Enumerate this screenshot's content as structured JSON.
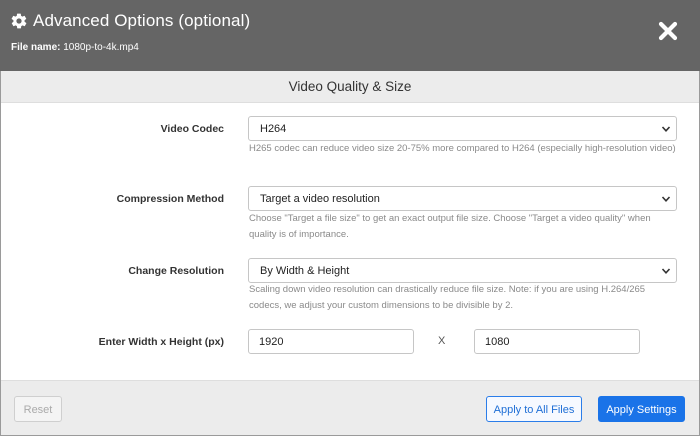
{
  "header": {
    "title": "Advanced Options (optional)",
    "file_label": "File name:",
    "file_name": "1080p-to-4k.mp4",
    "title_icon": "gear-icon",
    "close_icon": "close-icon"
  },
  "section": {
    "title": "Video Quality & Size"
  },
  "fields": {
    "codec": {
      "label": "Video Codec",
      "value": "H264",
      "help": "H265 codec can reduce video size 20-75% more compared to H264 (especially high-resolution video)"
    },
    "compression": {
      "label": "Compression Method",
      "value": "Target a video resolution",
      "help1": "Choose \"Target a file size\" to get an exact output file size. Choose \"Target a video quality\" when",
      "help2": "quality is of importance."
    },
    "resolution": {
      "label": "Change Resolution",
      "value": "By Width & Height",
      "help1": "Scaling down video resolution can drastically reduce file size. Note: if you are using H.264/265",
      "help2": "codecs, we adjust your custom dimensions to be divisible by 2."
    },
    "dimensions": {
      "label": "Enter Width x Height (px)",
      "width": "1920",
      "separator": "X",
      "height": "1080"
    }
  },
  "footer": {
    "reset": "Reset",
    "apply_all": "Apply to All Files",
    "apply": "Apply Settings"
  },
  "colors": {
    "header_bg": "#656565",
    "accent": "#1a73e8",
    "section_bg": "#ececec"
  }
}
